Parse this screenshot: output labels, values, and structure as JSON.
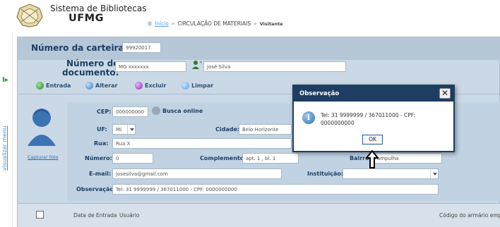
{
  "header": {
    "system_name": "Sistema de Bibliotecas",
    "org": "UFMG"
  },
  "breadcrumb": {
    "home": "Início",
    "separator": "»",
    "section": "CIRCULAÇÃO DE MATERIAIS",
    "current": "Visitante"
  },
  "rail": {
    "toggle_label": "visualizar menu"
  },
  "top": {
    "card_label": "Número da carteira:",
    "card_value": "99920017",
    "doc_label_1": "Número do",
    "doc_label_2": "documento:",
    "doc_value": "MG xxxxxxx",
    "name_value": "José Silva"
  },
  "toolbar": {
    "entrada": "Entrada",
    "alterar": "Alterar",
    "excluir": "Excluir",
    "limpar": "Limpar"
  },
  "photo": {
    "capture_label": "Capturar foto"
  },
  "form": {
    "cep_label": "CEP:",
    "cep_value": "000000000",
    "cep_search": "Busca online",
    "uf_label": "UF:",
    "uf_value": "M(",
    "cidade_label": "Cidade:",
    "cidade_value": "Belo Horizonte",
    "rua_label": "Rua:",
    "rua_value": "Rua X",
    "numero_label": "Número:",
    "numero_value": "0",
    "complemento_label": "Complemento:",
    "complemento_value": "apt. 1 , bl. 1",
    "bairro_label": "Bairro:",
    "bairro_value": "Pampulha",
    "email_label": "E-mail:",
    "email_value": "josesilva@gmail.com",
    "instituicao_label": "Instituição:",
    "instituicao_value": "",
    "observacao_label": "Observação",
    "observacao_value": "Tel: 31 9999999 / 367011000 - CPF: 0000000000"
  },
  "table": {
    "columns": [
      "Data de Entrada",
      "Usuário",
      "Código do armário empre"
    ]
  },
  "dialog": {
    "title": "Observação",
    "close": "✕",
    "message": "Tel: 31 9999999 / 367011000 - CPF: 0000000000",
    "ok": "OK"
  },
  "colors": {
    "dialog_title_bg": "#1d3d63",
    "label_color": "#1c3f66",
    "panel_bg": "#cbd9e6"
  }
}
